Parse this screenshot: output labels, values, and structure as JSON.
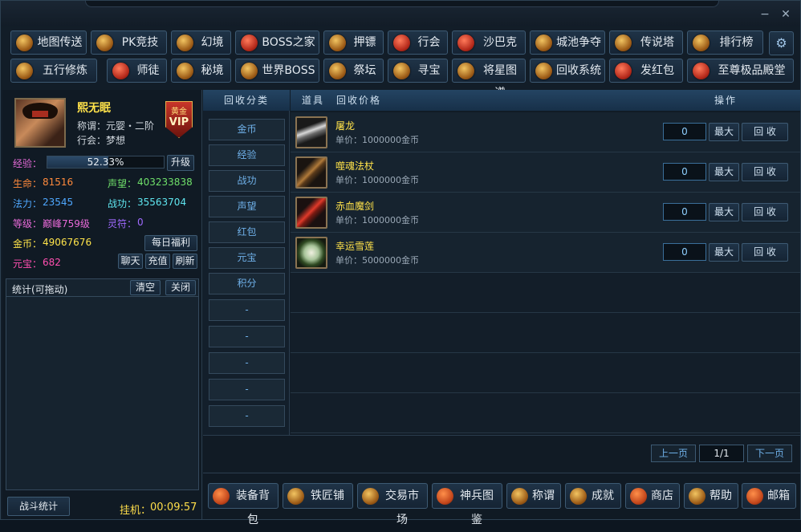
{
  "window": {
    "min_icon": "minimize-icon",
    "close_icon": "close-icon",
    "min": "−",
    "close": "✕"
  },
  "nav": {
    "row1": [
      "地图传送",
      "PK竞技场",
      "幻境",
      "BOSS之家",
      "押镖",
      "行会",
      "沙巴克",
      "城池争夺",
      "传说塔",
      "排行榜"
    ],
    "row2": [
      "五行修炼",
      "师徒",
      "秘境",
      "世界BOSS",
      "祭坛",
      "寻宝",
      "将星图谱",
      "回收系统",
      "发红包",
      "至尊极品殿堂"
    ],
    "settings_icon": "⚙"
  },
  "player": {
    "name": "熙无眠",
    "title": "称谓：元婴・二阶",
    "guild": "行会：梦想",
    "vip_top": "黄金",
    "vip_bottom": "VIP",
    "exp_label": "经验：",
    "exp_text": "52.33%",
    "exp_fraction": 0.5233,
    "upgrade": "升级",
    "life_label": "生命：",
    "life": "81516",
    "fame_label": "声望：",
    "fame": "403233838",
    "mana_label": "法力：",
    "mana": "23545",
    "power_label": "战功：",
    "power": "35563704",
    "level_label": "等级：",
    "level": "巅峰759级",
    "rune_label": "灵符：",
    "rune": "0",
    "gold_label": "金币：",
    "gold": "49067676",
    "ingot_label": "元宝：",
    "ingot": "682",
    "daily": "每日福利",
    "chat": "聊天",
    "recharge": "充值",
    "refresh": "刷新"
  },
  "stats": {
    "title": "统计(可拖动)",
    "clear": "清空",
    "close": "关闭",
    "battle": "战斗统计",
    "hang": "挂机：",
    "hang_time": "00:09:57"
  },
  "categories": {
    "header": "回收分类",
    "items": [
      "金币",
      "经验",
      "战功",
      "声望",
      "红包",
      "元宝",
      "积分",
      "-",
      "-",
      "-",
      "-",
      "-"
    ]
  },
  "list": {
    "col_item": "道具",
    "col_price": "回收价格",
    "col_action": "操作",
    "rows": [
      {
        "name": "屠龙",
        "price": "单价：1000000金币",
        "qty": "0",
        "max": "最大",
        "recycle": "回 收"
      },
      {
        "name": "噬魂法杖",
        "price": "单价：1000000金币",
        "qty": "0",
        "max": "最大",
        "recycle": "回 收"
      },
      {
        "name": "赤血魔剑",
        "price": "单价：1000000金币",
        "qty": "0",
        "max": "最大",
        "recycle": "回 收"
      },
      {
        "name": "幸运雪莲",
        "price": "单价：5000000金币",
        "qty": "0",
        "max": "最大",
        "recycle": "回 收"
      }
    ]
  },
  "pager": {
    "prev": "上一页",
    "page": "1/1",
    "next": "下一页"
  },
  "bottom": [
    "装备背包",
    "铁匠铺",
    "交易市场",
    "神兵图鉴",
    "称谓",
    "成就",
    "商店",
    "帮助",
    "邮箱"
  ]
}
